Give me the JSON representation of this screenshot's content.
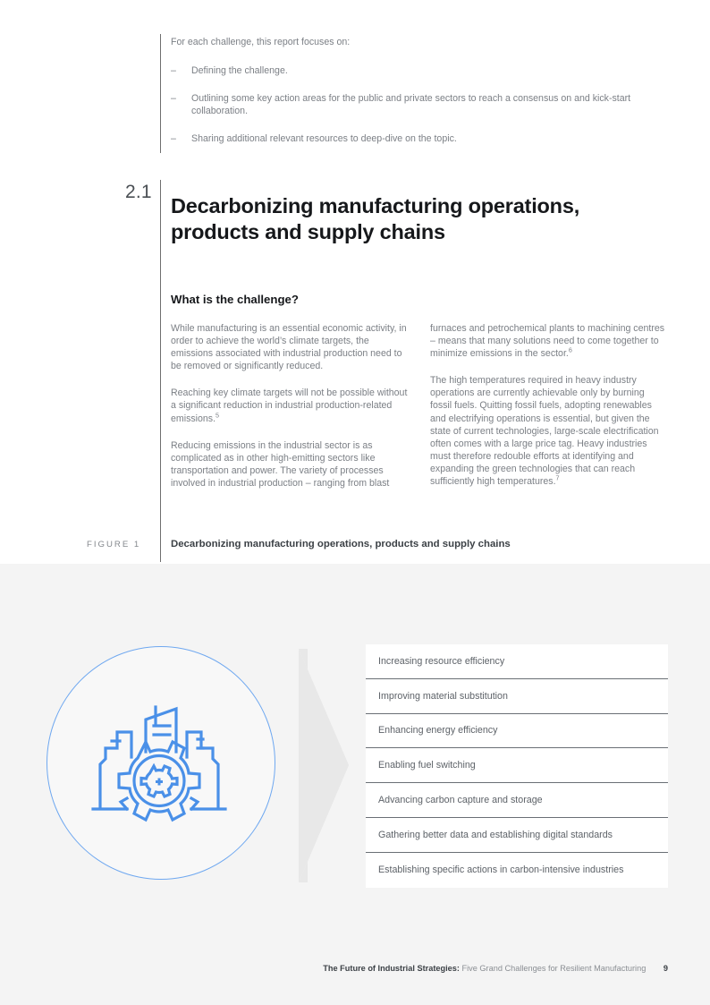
{
  "intro": {
    "lead": "For each challenge, this report focuses on:",
    "dash": "–",
    "items": [
      "Defining the challenge.",
      "Outlining some key action areas for the public and private sectors to reach a consensus on and kick-start collaboration.",
      "Sharing additional relevant resources to deep-dive on the topic."
    ]
  },
  "section": {
    "number": "2.1",
    "title": "Decarbonizing manufacturing operations, products and supply chains",
    "subheading": "What is the challenge?"
  },
  "body": {
    "left": [
      {
        "text": "While manufacturing is an essential economic activity, in order to achieve the world’s climate targets, the emissions associated with industrial production need to be removed or significantly reduced.",
        "note": ""
      },
      {
        "text": "Reaching key climate targets will not be possible without a significant reduction in industrial production-related emissions.",
        "note": "5"
      },
      {
        "text": "Reducing emissions in the industrial sector is as complicated as in other high-emitting sectors like transportation and power. The variety of processes involved in industrial production – ranging from blast",
        "note": ""
      }
    ],
    "right": [
      {
        "text": "furnaces and petrochemical plants to machining centres –  means that many solutions need to come together to minimize emissions in the sector.",
        "note": "6"
      },
      {
        "text": "The high temperatures required in heavy industry operations are currently achievable only by burning fossil fuels. Quitting fossil fuels, adopting renewables and electrifying operations is essential, but given the state of current technologies, large-scale electrification often comes with a large price tag. Heavy industries must therefore redouble efforts at identifying and expanding the green technologies that can reach sufficiently high temperatures.",
        "note": "7"
      }
    ]
  },
  "figure": {
    "label": "FIGURE 1",
    "caption": "Decarbonizing manufacturing operations, products and supply chains",
    "icon_name": "factory-gear-icon",
    "icon_color": "#4a90e8",
    "circle_color": "#6fa8f0",
    "arrow_color": "#e6e6e6",
    "items": [
      "Increasing resource efficiency",
      "Improving material substitution",
      "Enhancing energy efficiency",
      "Enabling fuel switching",
      "Advancing carbon capture and storage",
      "Gathering better data and establishing digital standards",
      "Establishing specific actions in carbon-intensive industries"
    ]
  },
  "footer": {
    "title": "The Future of Industrial Strategies:",
    "subtitle": "Five Grand Challenges for Resilient Manufacturing",
    "page": "9"
  }
}
